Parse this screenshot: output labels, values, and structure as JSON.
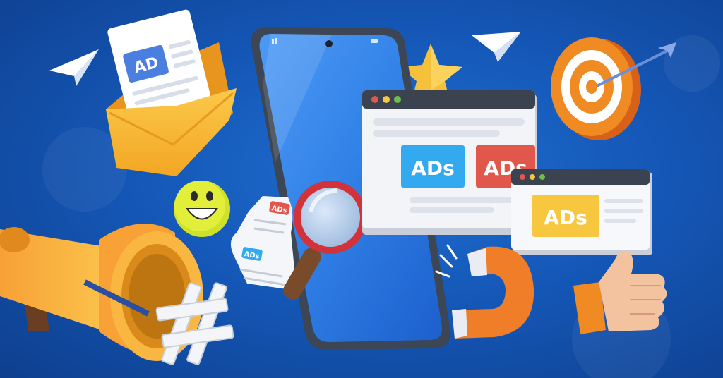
{
  "illustration": {
    "envelope_card_label": "AD",
    "browser_large_ad_left": "ADs",
    "browser_large_ad_right": "ADs",
    "browser_small_ad": "ADs",
    "receipt_top_tag": "ADs",
    "receipt_bottom_tag": "ADs"
  },
  "colors": {
    "background": "#1558b8",
    "ad_blue": "#33a9f0",
    "ad_red": "#e2574c",
    "ad_yellow": "#f7c740",
    "orange": "#f08a22"
  }
}
